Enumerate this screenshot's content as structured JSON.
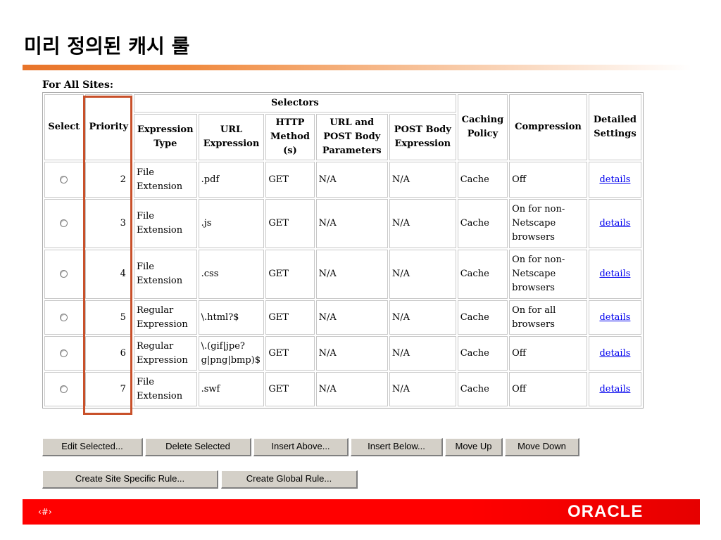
{
  "slide": {
    "title": "미리 정의된 캐시 룰",
    "page_number": "‹#›",
    "logo": "ORACLE"
  },
  "section_label": "For All Sites:",
  "table": {
    "headers": {
      "select": "Select",
      "priority": "Priority",
      "selectors": "Selectors",
      "expression_type": "Expression Type",
      "url_expression": "URL Expression",
      "http_method": "HTTP Method (s)",
      "url_post_params": "URL and POST Body Parameters",
      "post_body_expression": "POST Body Expression",
      "caching_policy": "Caching Policy",
      "compression": "Compression",
      "detailed_settings": "Detailed Settings"
    },
    "rows": [
      {
        "priority": "2",
        "expression_type": "File Extension",
        "url_expression": ".pdf",
        "http_method": "GET",
        "url_post_params": "N/A",
        "post_body_expression": "N/A",
        "caching_policy": "Cache",
        "compression": "Off",
        "details": "details"
      },
      {
        "priority": "3",
        "expression_type": "File Extension",
        "url_expression": ".js",
        "http_method": "GET",
        "url_post_params": "N/A",
        "post_body_expression": "N/A",
        "caching_policy": "Cache",
        "compression": "On for non-Netscape browsers",
        "details": "details"
      },
      {
        "priority": "4",
        "expression_type": "File Extension",
        "url_expression": ".css",
        "http_method": "GET",
        "url_post_params": "N/A",
        "post_body_expression": "N/A",
        "caching_policy": "Cache",
        "compression": "On for non-Netscape browsers",
        "details": "details"
      },
      {
        "priority": "5",
        "expression_type": "Regular Expression",
        "url_expression": "\\.html?$",
        "http_method": "GET",
        "url_post_params": "N/A",
        "post_body_expression": "N/A",
        "caching_policy": "Cache",
        "compression": "On for all browsers",
        "details": "details"
      },
      {
        "priority": "6",
        "expression_type": "Regular Expression",
        "url_expression": "\\.(gif|jpe?g|png|bmp)$",
        "http_method": "GET",
        "url_post_params": "N/A",
        "post_body_expression": "N/A",
        "caching_policy": "Cache",
        "compression": "Off",
        "details": "details"
      },
      {
        "priority": "7",
        "expression_type": "File Extension",
        "url_expression": ".swf",
        "http_method": "GET",
        "url_post_params": "N/A",
        "post_body_expression": "N/A",
        "caching_policy": "Cache",
        "compression": "Off",
        "details": "details"
      }
    ]
  },
  "buttons": {
    "edit_selected": "Edit Selected...",
    "delete_selected": "Delete Selected",
    "insert_above": "Insert Above...",
    "insert_below": "Insert Below...",
    "move_up": "Move Up",
    "move_down": "Move Down",
    "create_site_specific": "Create Site Specific Rule...",
    "create_global": "Create Global Rule..."
  },
  "colors": {
    "accent_orange": "#e8742a",
    "highlight_border": "#c8502a",
    "footer_red": "#ff0000",
    "link_blue": "#0000ee"
  }
}
